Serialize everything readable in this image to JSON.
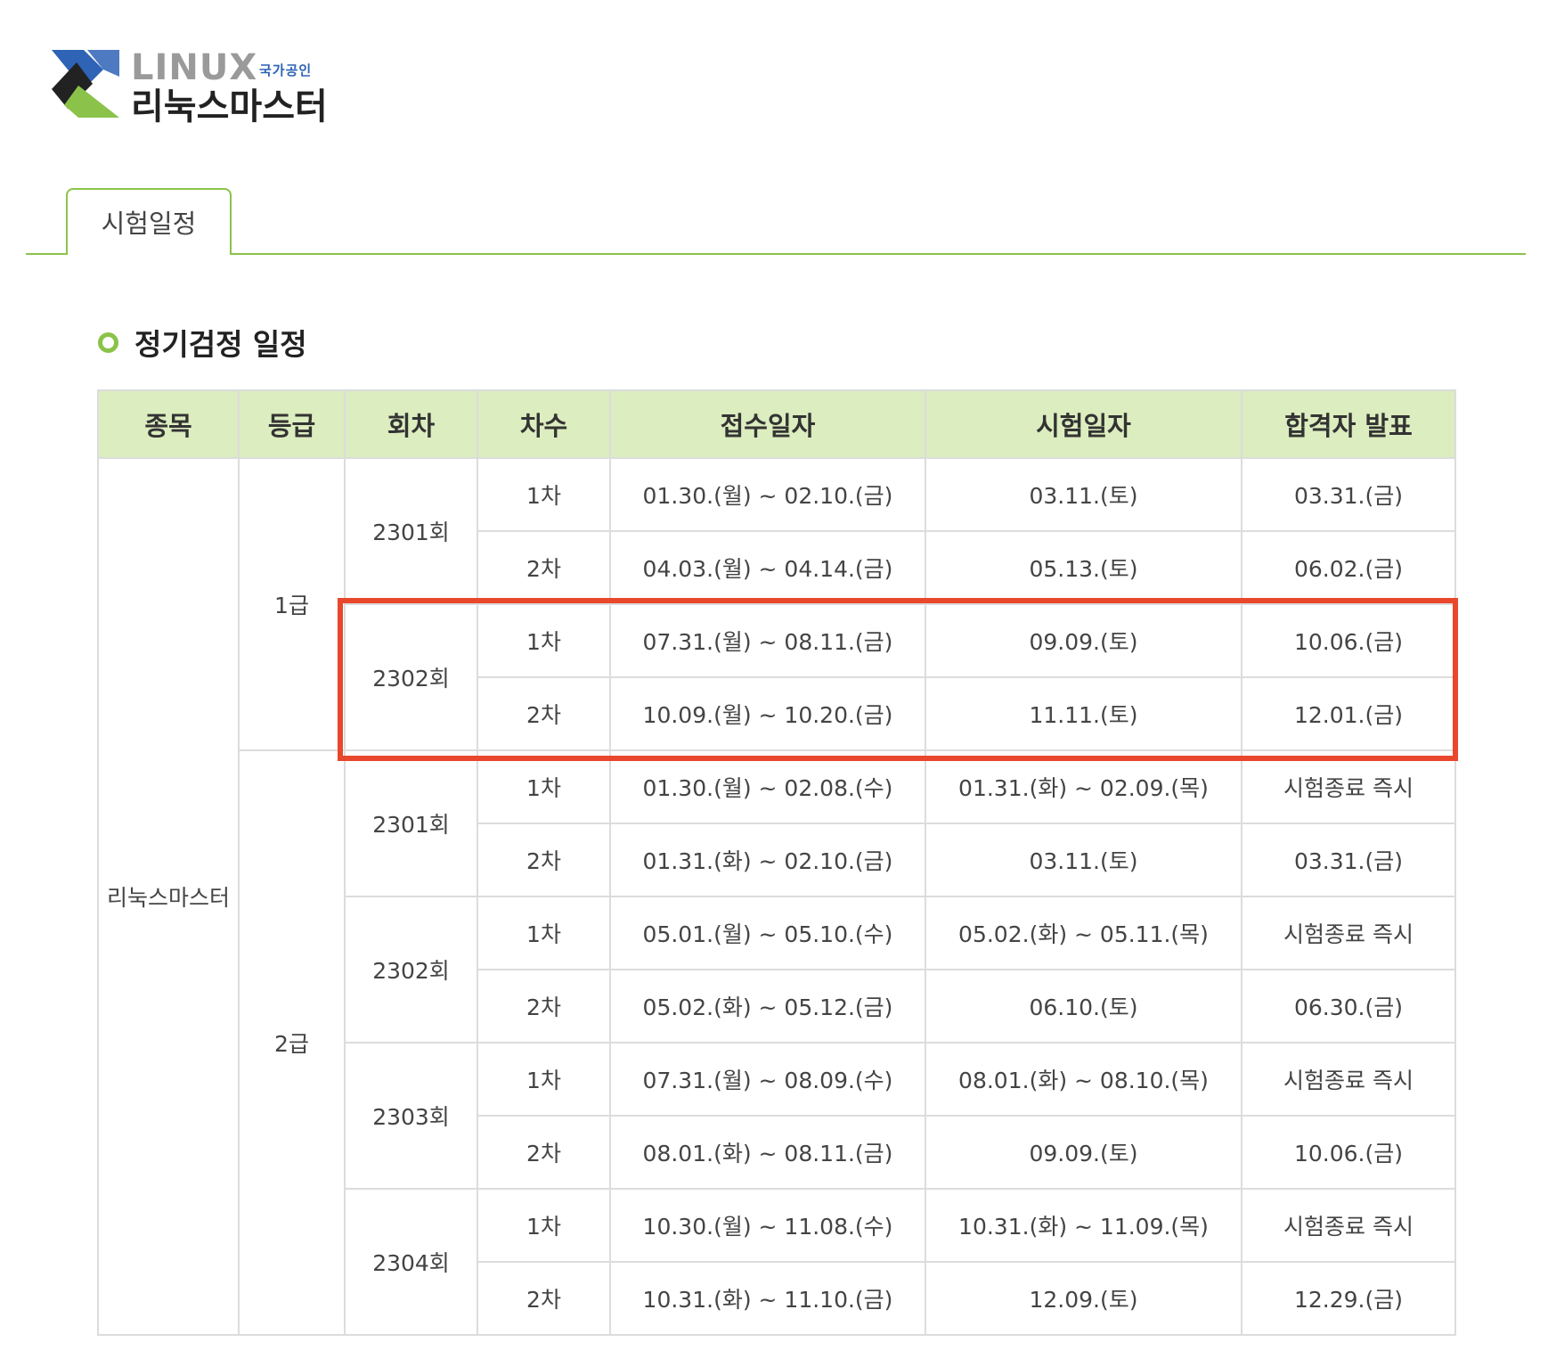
{
  "logo": {
    "word": "LINUX",
    "badge": "국가공인",
    "name": "리눅스마스터"
  },
  "tab": {
    "label": "시험일정"
  },
  "section": {
    "title": "정기검정 일정"
  },
  "colors": {
    "accent": "#8bc34a",
    "header_bg": "#dcedbf",
    "highlight": "#e8472c",
    "logo_blue": "#2e63b5"
  },
  "table": {
    "headers": [
      "종목",
      "등급",
      "회차",
      "차수",
      "접수일자",
      "시험일자",
      "합격자 발표"
    ],
    "subject": "리눅스마스터",
    "grades": [
      "1급",
      "2급"
    ],
    "sessions": [
      "2301회",
      "2302회",
      "2301회",
      "2302회",
      "2303회",
      "2304회"
    ],
    "rows": [
      {
        "round": "1차",
        "apply": "01.30.(월) ~ 02.10.(금)",
        "exam": "03.11.(토)",
        "result": "03.31.(금)"
      },
      {
        "round": "2차",
        "apply": "04.03.(월) ~ 04.14.(금)",
        "exam": "05.13.(토)",
        "result": "06.02.(금)"
      },
      {
        "round": "1차",
        "apply": "07.31.(월) ~ 08.11.(금)",
        "exam": "09.09.(토)",
        "result": "10.06.(금)"
      },
      {
        "round": "2차",
        "apply": "10.09.(월) ~ 10.20.(금)",
        "exam": "11.11.(토)",
        "result": "12.01.(금)"
      },
      {
        "round": "1차",
        "apply": "01.30.(월) ~ 02.08.(수)",
        "exam": "01.31.(화) ~ 02.09.(목)",
        "result": "시험종료 즉시"
      },
      {
        "round": "2차",
        "apply": "01.31.(화) ~ 02.10.(금)",
        "exam": "03.11.(토)",
        "result": "03.31.(금)"
      },
      {
        "round": "1차",
        "apply": "05.01.(월) ~ 05.10.(수)",
        "exam": "05.02.(화) ~ 05.11.(목)",
        "result": "시험종료 즉시"
      },
      {
        "round": "2차",
        "apply": "05.02.(화) ~ 05.12.(금)",
        "exam": "06.10.(토)",
        "result": "06.30.(금)"
      },
      {
        "round": "1차",
        "apply": "07.31.(월) ~ 08.09.(수)",
        "exam": "08.01.(화) ~ 08.10.(목)",
        "result": "시험종료 즉시"
      },
      {
        "round": "2차",
        "apply": "08.01.(화) ~ 08.11.(금)",
        "exam": "09.09.(토)",
        "result": "10.06.(금)"
      },
      {
        "round": "1차",
        "apply": "10.30.(월) ~ 11.08.(수)",
        "exam": "10.31.(화) ~ 11.09.(목)",
        "result": "시험종료 즉시"
      },
      {
        "round": "2차",
        "apply": "10.31.(화) ~ 11.10.(금)",
        "exam": "12.09.(토)",
        "result": "12.29.(금)"
      }
    ]
  }
}
